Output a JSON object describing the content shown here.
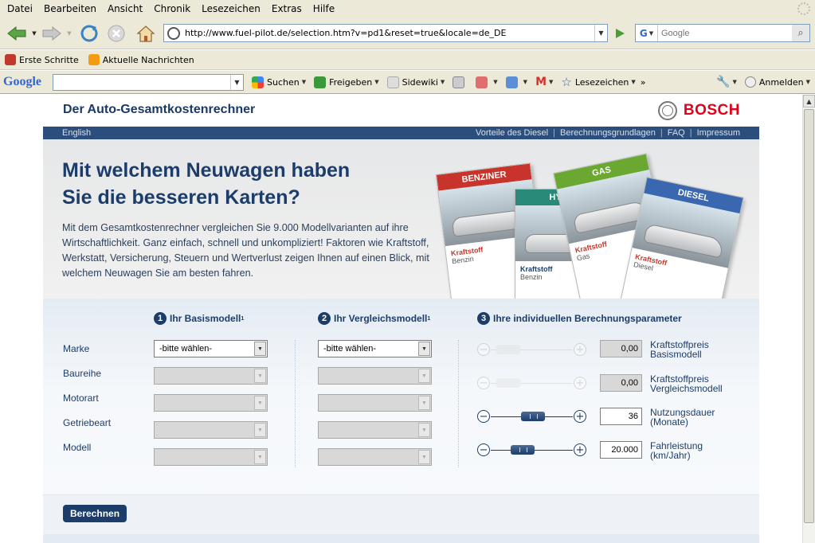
{
  "browser": {
    "menu": [
      "Datei",
      "Bearbeiten",
      "Ansicht",
      "Chronik",
      "Lesezeichen",
      "Extras",
      "Hilfe"
    ],
    "url": "http://www.fuel-pilot.de/selection.htm?v=pd1&reset=true&locale=de_DE",
    "search_placeholder": "Google",
    "bookmarks": [
      "Erste Schritte",
      "Aktuelle Nachrichten"
    ],
    "google_toolbar": {
      "logo": "Google",
      "items": [
        "Suchen",
        "Freigeben",
        "Sidewiki",
        "Lesezeichen"
      ],
      "signin": "Anmelden"
    }
  },
  "site": {
    "title": "Der Auto-Gesamtkostenrechner",
    "brand": "BOSCH",
    "nav_left": "English",
    "nav_links": [
      "Vorteile des Diesel",
      "Berechnungsgrundlagen",
      "FAQ",
      "Impressum"
    ],
    "hero": {
      "headline_1": "Mit welchem Neuwagen haben",
      "headline_2": "Sie die besseren Karten?",
      "text": "Mit dem Gesamtkostenrechner vergleichen Sie 9.000 Modellvarianten auf ihre Wirtschaftlichkeit. Ganz einfach, schnell und unkompliziert! Faktoren wie Kraftstoff, Werkstatt, Versicherung, Steuern und Wertverlust zeigen Ihnen auf einen Blick, mit welchem Neuwagen Sie am besten fahren.",
      "cards": [
        {
          "label": "BENZINER",
          "kf": "Kraftstoff",
          "sub": "Benzin",
          "color": "#c8342b"
        },
        {
          "label": "HYB",
          "kf": "Kraftstoff",
          "sub": "Benzin",
          "color": "#2a8a7a"
        },
        {
          "label": "GAS",
          "kf": "Kraftstoff",
          "sub": "Gas",
          "color": "#6aa832"
        },
        {
          "label": "DIESEL",
          "kf": "Kraftstoff",
          "sub": "Diesel",
          "color": "#3a68b0"
        }
      ]
    },
    "form": {
      "col1": {
        "num": "1",
        "title": "Ihr Basismodell"
      },
      "col2": {
        "num": "2",
        "title": "Ihr Vergleichsmodell"
      },
      "col3": {
        "num": "3",
        "title": "Ihre individuellen Berechnungsparameter"
      },
      "row_labels": [
        "Marke",
        "Baureihe",
        "Motorart",
        "Getriebeart",
        "Modell"
      ],
      "marke_default": "-bitte wählen-",
      "params": [
        {
          "value": "0,00",
          "label_1": "Kraftstoffpreis",
          "label_2": "Basismodell",
          "enabled": false
        },
        {
          "value": "0,00",
          "label_1": "Kraftstoffpreis",
          "label_2": "Vergleichsmodell",
          "enabled": false
        },
        {
          "value": "36",
          "label_1": "Nutzungsdauer",
          "label_2": "(Monate)",
          "enabled": true
        },
        {
          "value": "20.000",
          "label_1": "Fahrleistung",
          "label_2": "(km/Jahr)",
          "enabled": true
        }
      ],
      "submit": "Berechnen"
    }
  },
  "colors": {
    "brand_red": "#e2001a",
    "navy": "#1c3d6a",
    "nav_blue": "#2c4e7c"
  }
}
